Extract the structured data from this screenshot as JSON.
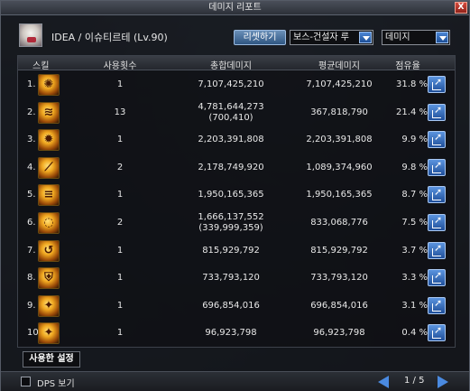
{
  "window": {
    "title": "데미지 리포트",
    "close_label": "X"
  },
  "header": {
    "character": "IDEA / 이슈티르테 (Lv.90)",
    "reset_label": "리셋하기",
    "mode_select": "보스-건설자 루",
    "type_select": "데미지"
  },
  "columns": {
    "skill": "스킬",
    "uses": "사용횟수",
    "total": "총합데미지",
    "average": "평균데미지",
    "share": "점유율"
  },
  "rows": [
    {
      "rank": "1.",
      "uses": "1",
      "total": "7,107,425,210",
      "total_sub": "",
      "average": "7,107,425,210",
      "share": "31.8 %"
    },
    {
      "rank": "2.",
      "uses": "13",
      "total": "4,781,644,273",
      "total_sub": "(700,410)",
      "average": "367,818,790",
      "share": "21.4 %"
    },
    {
      "rank": "3.",
      "uses": "1",
      "total": "2,203,391,808",
      "total_sub": "",
      "average": "2,203,391,808",
      "share": "9.9 %"
    },
    {
      "rank": "4.",
      "uses": "2",
      "total": "2,178,749,920",
      "total_sub": "",
      "average": "1,089,374,960",
      "share": "9.8 %"
    },
    {
      "rank": "5.",
      "uses": "1",
      "total": "1,950,165,365",
      "total_sub": "",
      "average": "1,950,165,365",
      "share": "8.7 %"
    },
    {
      "rank": "6.",
      "uses": "2",
      "total": "1,666,137,552",
      "total_sub": "(339,999,359)",
      "average": "833,068,776",
      "share": "7.5 %"
    },
    {
      "rank": "7.",
      "uses": "1",
      "total": "815,929,792",
      "total_sub": "",
      "average": "815,929,792",
      "share": "3.7 %"
    },
    {
      "rank": "8.",
      "uses": "1",
      "total": "733,793,120",
      "total_sub": "",
      "average": "733,793,120",
      "share": "3.3 %"
    },
    {
      "rank": "9.",
      "uses": "1",
      "total": "696,854,016",
      "total_sub": "",
      "average": "696,854,016",
      "share": "3.1 %"
    },
    {
      "rank": "10.",
      "uses": "1",
      "total": "96,923,798",
      "total_sub": "",
      "average": "96,923,798",
      "share": "0.4 %"
    }
  ],
  "bottom": {
    "used_tab": "사용한 설정"
  },
  "footer": {
    "dps_label": "DPS 보기",
    "page": "1 / 5"
  },
  "icons": [
    "skill-icon-fire-swirl",
    "skill-icon-gold-wave",
    "skill-icon-gold-burst",
    "skill-icon-gold-slash",
    "skill-icon-gold-stream",
    "skill-icon-gold-arc",
    "skill-icon-gold-swoop",
    "skill-icon-gold-shield",
    "skill-icon-gold-orb",
    "skill-icon-gold-orb-2"
  ]
}
